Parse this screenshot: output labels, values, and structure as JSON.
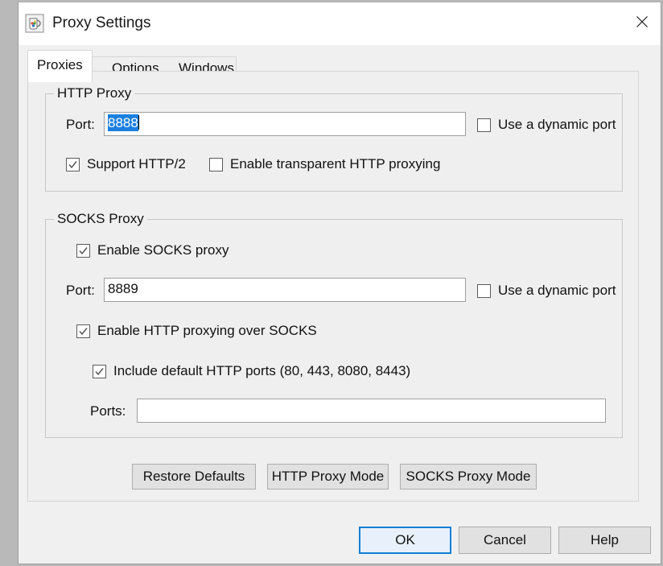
{
  "window": {
    "title": "Proxy Settings",
    "icon": "coffee-pitcher-icon",
    "close_label": "✕"
  },
  "tabs": [
    {
      "label": "Proxies",
      "selected": true
    },
    {
      "label": "Options",
      "selected": false
    },
    {
      "label": "Windows",
      "selected": false
    }
  ],
  "http_group": {
    "legend": "HTTP Proxy",
    "port_label": "Port:",
    "port_value": "8888",
    "port_selected": true,
    "dynamic_port_label": "Use a dynamic port",
    "dynamic_port_checked": false,
    "support_http2_label": "Support HTTP/2",
    "support_http2_checked": true,
    "transparent_label": "Enable transparent HTTP proxying",
    "transparent_checked": false
  },
  "socks_group": {
    "legend": "SOCKS Proxy",
    "enable_label": "Enable SOCKS proxy",
    "enable_checked": true,
    "port_label": "Port:",
    "port_value": "8889",
    "dynamic_port_label": "Use a dynamic port",
    "dynamic_port_checked": false,
    "http_over_socks_label": "Enable HTTP proxying over SOCKS",
    "http_over_socks_checked": true,
    "include_defaults_label": "Include default HTTP ports (80, 443, 8080, 8443)",
    "include_defaults_checked": true,
    "ports_label": "Ports:",
    "ports_value": "",
    "ports_placeholder": ""
  },
  "action_buttons": {
    "restore_defaults": "Restore Defaults",
    "http_proxy_mode": "HTTP Proxy Mode",
    "socks_proxy_mode": "SOCKS Proxy Mode"
  },
  "dialog_buttons": {
    "ok": "OK",
    "cancel": "Cancel",
    "help": "Help"
  },
  "colors": {
    "window_bg": "#f0f0f0",
    "panel_bg": "#efefef",
    "selection_blue": "#1a7fe0",
    "default_button_border": "#0f7fd4",
    "button_bg": "#e1e1e1"
  }
}
